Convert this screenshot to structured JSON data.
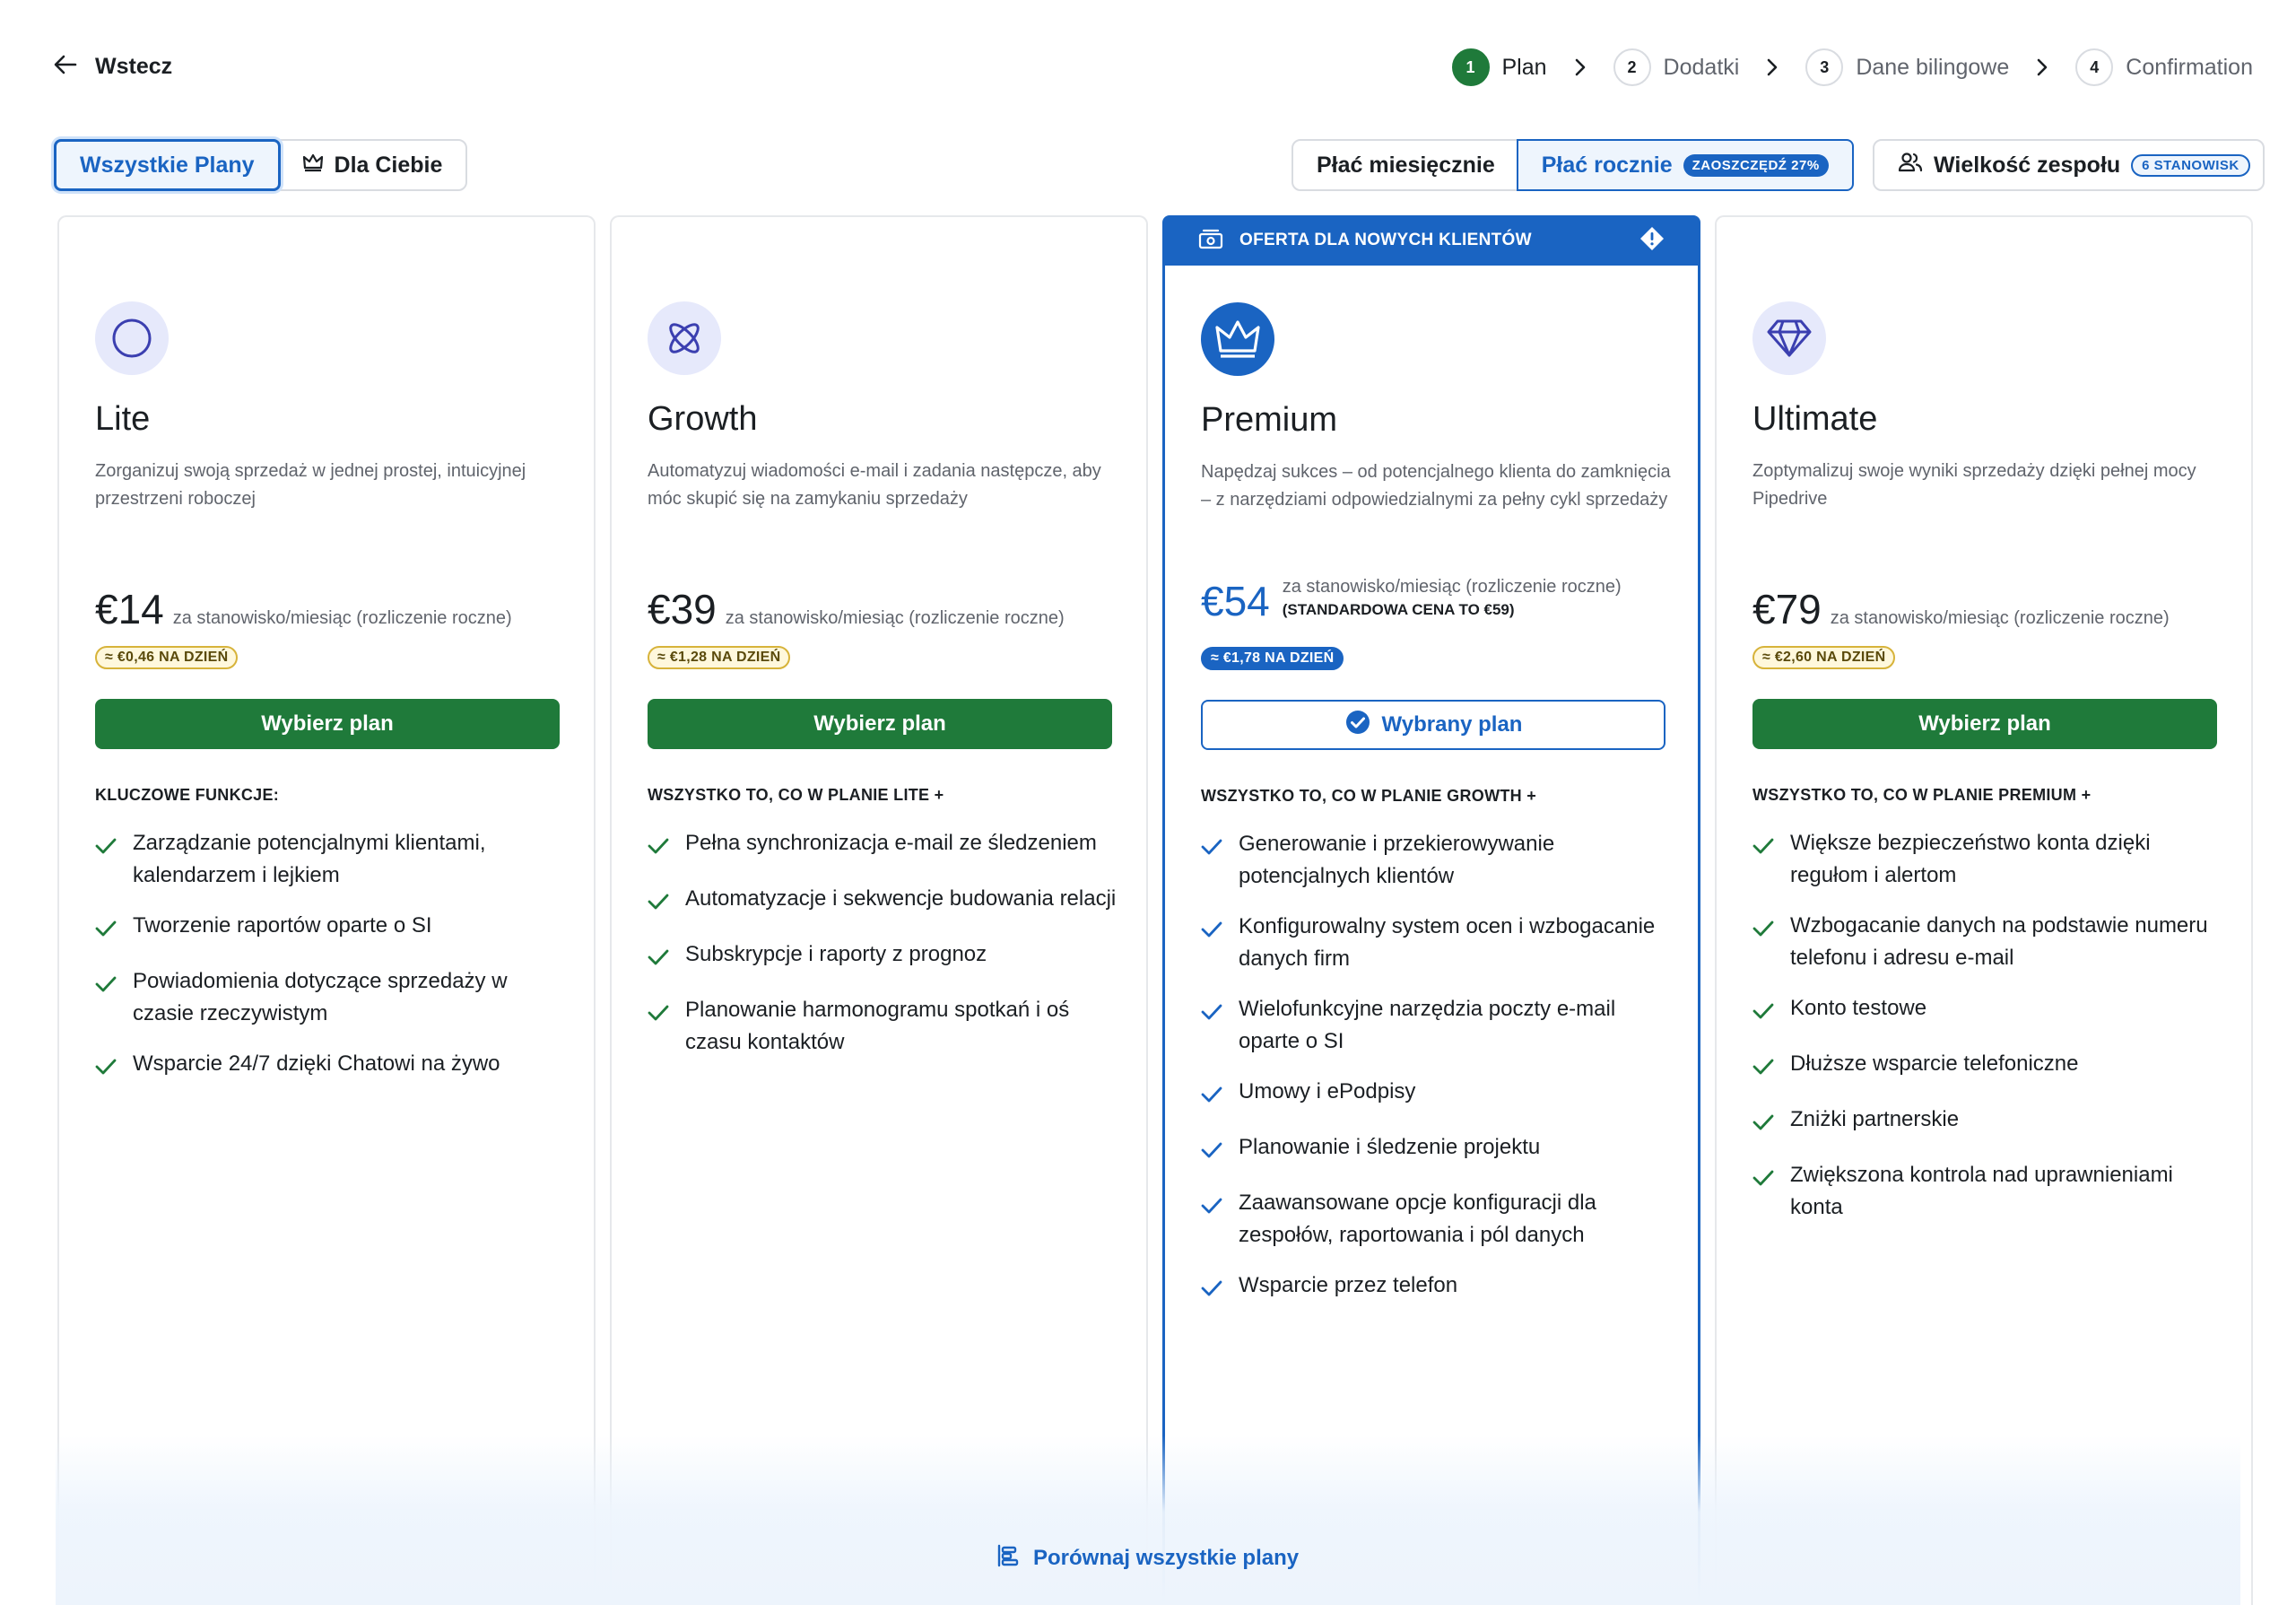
{
  "header": {
    "back_label": "Wstecz",
    "steps": [
      {
        "num": "1",
        "label": "Plan",
        "active": true
      },
      {
        "num": "2",
        "label": "Dodatki",
        "active": false
      },
      {
        "num": "3",
        "label": "Dane bilingowe",
        "active": false
      },
      {
        "num": "4",
        "label": "Confirmation",
        "active": false
      }
    ]
  },
  "filters": {
    "all_plans": "Wszystkie Plany",
    "for_you": "Dla Ciebie"
  },
  "billing": {
    "monthly": "Płać miesięcznie",
    "yearly": "Płać rocznie",
    "save_badge": "ZAOSZCZĘDŹ 27%",
    "selected": "yearly"
  },
  "team": {
    "label": "Wielkość zespołu",
    "seats_badge": "6 STANOWISK"
  },
  "colors": {
    "primary_blue": "#1a64c2",
    "cta_green": "#1f7a3a",
    "day_badge_yellow": "#fff8dc"
  },
  "plans": [
    {
      "name": "Lite",
      "icon": "circle-icon",
      "description": "Zorganizuj swoją sprzedaż w jednej prostej, intuicyjnej przestrzeni roboczej",
      "price": "€14",
      "per": "za stanowisko/miesiąc (rozliczenie roczne)",
      "per_day": "≈ €0,46 NA DZIEŃ",
      "button": "Wybierz plan",
      "features_title": "KLUCZOWE FUNKCJE:",
      "features": [
        "Zarządzanie potencjalnymi klientami, kalendarzem i lejkiem",
        "Tworzenie raportów oparte o SI",
        "Powiadomienia dotyczące sprzedaży w czasie rzeczywistym",
        "Wsparcie 24/7 dzięki Chatowi na żywo"
      ]
    },
    {
      "name": "Growth",
      "icon": "orbit-icon",
      "description": "Automatyzuj wiadomości e-mail i zadania następcze, aby móc skupić się na zamykaniu sprzedaży",
      "price": "€39",
      "per": "za stanowisko/miesiąc (rozliczenie roczne)",
      "per_day": "≈ €1,28 NA DZIEŃ",
      "button": "Wybierz plan",
      "features_title": "WSZYSTKO TO, CO W PLANIE LITE +",
      "features": [
        "Pełna synchronizacja e-mail ze śledzeniem",
        "Automatyzacje i sekwencje budowania relacji",
        "Subskrypcje i raporty z prognoz",
        "Planowanie harmonogramu spotkań i oś czasu kontaktów"
      ]
    },
    {
      "name": "Premium",
      "icon": "crown-icon",
      "offer": "OFERTA DLA NOWYCH KLIENTÓW",
      "description": "Napędzaj sukces – od potencjalnego klienta do zamknięcia – z narzędziami odpowiedzialnymi za pełny cykl sprzedaży",
      "price": "€54",
      "per": "za stanowisko/miesiąc (rozliczenie roczne)",
      "standard_price": "(STANDARDOWA CENA TO €59)",
      "per_day": "≈ €1,78 NA DZIEŃ",
      "button": "Wybrany plan",
      "features_title": "WSZYSTKO TO, CO W PLANIE GROWTH +",
      "features": [
        "Generowanie i przekierowywanie potencjalnych klientów",
        "Konfigurowalny system ocen i wzbogacanie danych firm",
        "Wielofunkcyjne narzędzia poczty e-mail oparte o SI",
        "Umowy i ePodpisy",
        "Planowanie i śledzenie projektu",
        "Zaawansowane opcje konfiguracji dla zespołów, raportowania i pól danych",
        "Wsparcie przez telefon"
      ]
    },
    {
      "name": "Ultimate",
      "icon": "diamond-icon",
      "description": "Zoptymalizuj swoje wyniki sprzedaży dzięki pełnej mocy Pipedrive",
      "price": "€79",
      "per": "za stanowisko/miesiąc (rozliczenie roczne)",
      "per_day": "≈ €2,60 NA DZIEŃ",
      "button": "Wybierz plan",
      "features_title": "WSZYSTKO TO, CO W PLANIE PREMIUM +",
      "features": [
        "Większe bezpieczeństwo konta dzięki regułom i alertom",
        "Wzbogacanie danych na podstawie numeru telefonu i adresu e-mail",
        "Konto testowe",
        "Dłuższe wsparcie telefoniczne",
        "Zniżki partnerskie",
        "Zwiększona kontrola nad uprawnieniami konta"
      ]
    }
  ],
  "compare": {
    "label": "Porównaj wszystkie plany"
  }
}
